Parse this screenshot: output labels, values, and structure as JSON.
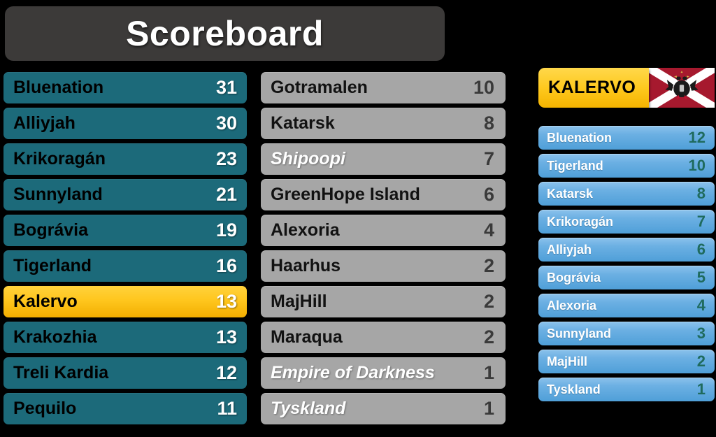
{
  "header": {
    "title": "Scoreboard"
  },
  "colors": {
    "background": "#000000",
    "title_bar": "#3c3a39",
    "teal_row": "#1c6a7a",
    "gray_row": "#a6a6a6",
    "gold_row": "#ffc61e",
    "blue_row": "#6cb0e3",
    "blue_score": "#1f6b5e",
    "flag_red": "#a6192e",
    "flag_white": "#ffffff",
    "flag_eagle": "#1a1a1a"
  },
  "main_standings": {
    "left_column": [
      {
        "name": "Bluenation",
        "score": "31",
        "style": "teal"
      },
      {
        "name": "Alliyjah",
        "score": "30",
        "style": "teal"
      },
      {
        "name": "Krikoragán",
        "score": "23",
        "style": "teal"
      },
      {
        "name": "Sunnyland",
        "score": "21",
        "style": "teal"
      },
      {
        "name": "Bográvia",
        "score": "19",
        "style": "teal"
      },
      {
        "name": "Tigerland",
        "score": "16",
        "style": "teal"
      },
      {
        "name": "Kalervo",
        "score": "13",
        "style": "highlight"
      },
      {
        "name": "Krakozhia",
        "score": "13",
        "style": "teal"
      },
      {
        "name": "Treli Kardia",
        "score": "12",
        "style": "teal"
      },
      {
        "name": "Pequilo",
        "score": "11",
        "style": "teal"
      }
    ],
    "middle_column": [
      {
        "name": "Gotramalen",
        "score": "10",
        "style": "gray"
      },
      {
        "name": "Katarsk",
        "score": "8",
        "style": "gray"
      },
      {
        "name": "Shipoopi",
        "score": "7",
        "style": "gray-italic"
      },
      {
        "name": "GreenHope Island",
        "score": "6",
        "style": "gray"
      },
      {
        "name": "Alexoria",
        "score": "4",
        "style": "gray"
      },
      {
        "name": "Haarhus",
        "score": "2",
        "style": "gray"
      },
      {
        "name": "MajHill",
        "score": "2",
        "style": "gray"
      },
      {
        "name": "Maraqua",
        "score": "2",
        "style": "gray"
      },
      {
        "name": "Empire of Darkness",
        "score": "1",
        "style": "gray-italic"
      },
      {
        "name": "Tyskland",
        "score": "1",
        "style": "gray-italic"
      }
    ]
  },
  "country_panel": {
    "title": "KALERVO",
    "flag_name": "kalervo-flag",
    "rows": [
      {
        "name": "Bluenation",
        "score": "12"
      },
      {
        "name": "Tigerland",
        "score": "10"
      },
      {
        "name": "Katarsk",
        "score": "8"
      },
      {
        "name": "Krikoragán",
        "score": "7"
      },
      {
        "name": "Alliyjah",
        "score": "6"
      },
      {
        "name": "Bográvia",
        "score": "5"
      },
      {
        "name": "Alexoria",
        "score": "4"
      },
      {
        "name": "Sunnyland",
        "score": "3"
      },
      {
        "name": "MajHill",
        "score": "2"
      },
      {
        "name": "Tyskland",
        "score": "1"
      }
    ]
  }
}
